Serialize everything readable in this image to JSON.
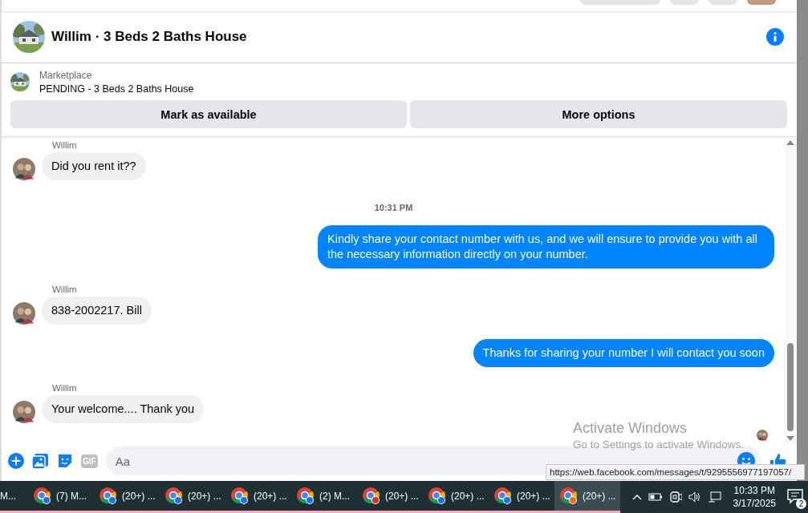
{
  "header": {
    "title": "Willim · 3 Beds 2 Baths House"
  },
  "listing": {
    "source": "Marketplace",
    "status": "PENDING - 3 Beds 2 Baths House",
    "actions": [
      "Mark as available",
      "More options"
    ]
  },
  "messages": [
    {
      "kind": "incoming",
      "sender": "Willim",
      "text": "Did you rent it??"
    },
    {
      "kind": "time",
      "text": "10:31 PM"
    },
    {
      "kind": "outgoing",
      "text": "Kindly share your contact number with us, and we will ensure to provide you with all the necessary information directly on your number."
    },
    {
      "kind": "incoming",
      "sender": "Willim",
      "text": "838-2002217. Bill"
    },
    {
      "kind": "outgoing",
      "text": "Thanks for sharing your number I will contact you soon"
    },
    {
      "kind": "incoming",
      "sender": "Willim",
      "text": "Your welcome.... Thank you"
    }
  ],
  "composer": {
    "gif_label": "GIF",
    "placeholder": "Aa"
  },
  "link_preview": "https://web.facebook.com/messages/t/9295556977197057/",
  "windows_notice": {
    "title": "Activate Windows",
    "text": "Go to Settings to activate Windows."
  },
  "taskbar": {
    "apps": [
      {
        "kind": "partial",
        "label": "M...",
        "selected": false
      },
      {
        "kind": "browser",
        "label": "(7) M...",
        "selected": false,
        "color": "#1a73e8"
      },
      {
        "kind": "browser",
        "label": "(20+) ...",
        "selected": false,
        "color": "#1a73e8"
      },
      {
        "kind": "browser",
        "label": "(20+) ...",
        "selected": false,
        "color": "#1a73e8"
      },
      {
        "kind": "browser",
        "label": "(20+) ...",
        "selected": false,
        "color": "#1a73e8"
      },
      {
        "kind": "browser",
        "label": "(2) M...",
        "selected": false,
        "color": "#1a73e8"
      },
      {
        "kind": "browser",
        "label": "(20+) ...",
        "selected": false,
        "color": "#d93025"
      },
      {
        "kind": "browser",
        "label": "(20+) ...",
        "selected": false,
        "color": "#1a73e8"
      },
      {
        "kind": "browser",
        "label": "(20+) ...",
        "selected": false,
        "color": "#1a73e8"
      },
      {
        "kind": "browser",
        "label": "(20+) ...",
        "selected": true,
        "color": "#e8710a"
      }
    ],
    "time": "10:33 PM",
    "date": "3/17/2025",
    "notifications": "2"
  }
}
